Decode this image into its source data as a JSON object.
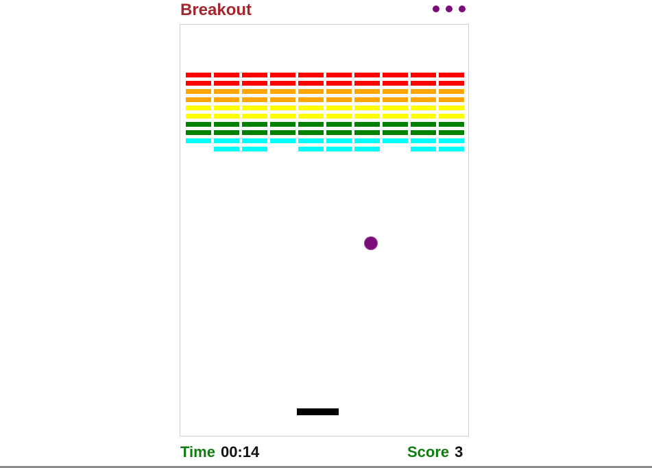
{
  "app": {
    "title": "Breakout"
  },
  "menu": {
    "icon": "more-dots-icon"
  },
  "status": {
    "time_label": "Time",
    "time_value": "00:14",
    "score_label": "Score",
    "score_value": "3"
  },
  "colors": {
    "title": "#a4262c",
    "accent": "#7b0c79",
    "status_label": "#107c10",
    "paddle": "#000000"
  },
  "bricks": {
    "rows": [
      {
        "color": "#ff0000",
        "present": [
          1,
          1,
          1,
          1,
          1,
          1,
          1,
          1,
          1,
          1
        ]
      },
      {
        "color": "#ff0000",
        "present": [
          1,
          1,
          1,
          1,
          1,
          1,
          1,
          1,
          1,
          1
        ]
      },
      {
        "color": "#ffa500",
        "present": [
          1,
          1,
          1,
          1,
          1,
          1,
          1,
          1,
          1,
          1
        ]
      },
      {
        "color": "#ffa500",
        "present": [
          1,
          1,
          1,
          1,
          1,
          1,
          1,
          1,
          1,
          1
        ]
      },
      {
        "color": "#ffff00",
        "present": [
          1,
          1,
          1,
          1,
          1,
          1,
          1,
          1,
          1,
          1
        ]
      },
      {
        "color": "#ffff00",
        "present": [
          1,
          1,
          1,
          1,
          1,
          1,
          1,
          1,
          1,
          1
        ]
      },
      {
        "color": "#008000",
        "present": [
          1,
          1,
          1,
          1,
          1,
          1,
          1,
          1,
          1,
          1
        ]
      },
      {
        "color": "#008000",
        "present": [
          1,
          1,
          1,
          1,
          1,
          1,
          1,
          1,
          1,
          1
        ]
      },
      {
        "color": "#00ffff",
        "present": [
          1,
          1,
          1,
          1,
          1,
          1,
          1,
          1,
          1,
          1
        ]
      },
      {
        "color": "#00ffff",
        "present": [
          0,
          1,
          1,
          0,
          1,
          1,
          1,
          0,
          1,
          1
        ]
      }
    ]
  }
}
